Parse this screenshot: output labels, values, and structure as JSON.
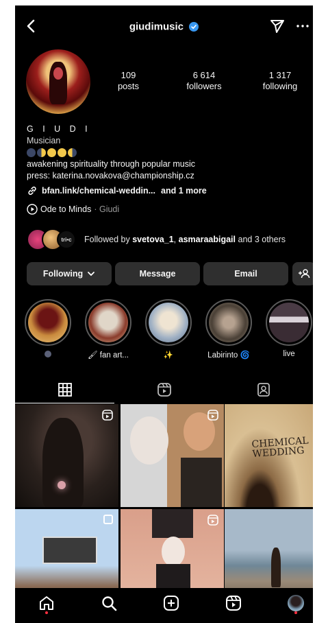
{
  "header": {
    "username": "giudimusic",
    "verified": true,
    "accent_color": "#3897f0"
  },
  "stats": {
    "posts": {
      "value": "109",
      "label": "posts"
    },
    "followers": {
      "value": "6 614",
      "label": "followers"
    },
    "following": {
      "value": "1 317",
      "label": "following"
    }
  },
  "bio": {
    "name": "G I U D I",
    "category": "Musician",
    "moon_phases": [
      "waning-crescent",
      "last-quarter",
      "full-moon",
      "full-moon",
      "first-quarter"
    ],
    "line1": "awakening spirituality through popular music",
    "line2": "press: katerina.novakova@championship.cz",
    "link": "bfan.link/chemical-weddin...",
    "link_more": "and 1 more",
    "music_title": "Ode to Minds",
    "music_artist": "· Giudi"
  },
  "followed_by": {
    "badge_text": "tri•c",
    "prefix": "Followed by",
    "user1": "svetova_1",
    "sep": ",",
    "user2": "asmaraabigail",
    "suffix": "and 3 others"
  },
  "actions": {
    "following": "Following",
    "message": "Message",
    "email": "Email"
  },
  "highlights": [
    {
      "label": ""
    },
    {
      "label": "fan art..."
    },
    {
      "label": "✨"
    },
    {
      "label": "Labirinto"
    },
    {
      "label": "live"
    }
  ],
  "grid_overlay_text": "CHEMICAL WEDDING",
  "colors": {
    "background": "#000000",
    "button": "#2f2f2f",
    "notification_dot": "#ff3040"
  }
}
